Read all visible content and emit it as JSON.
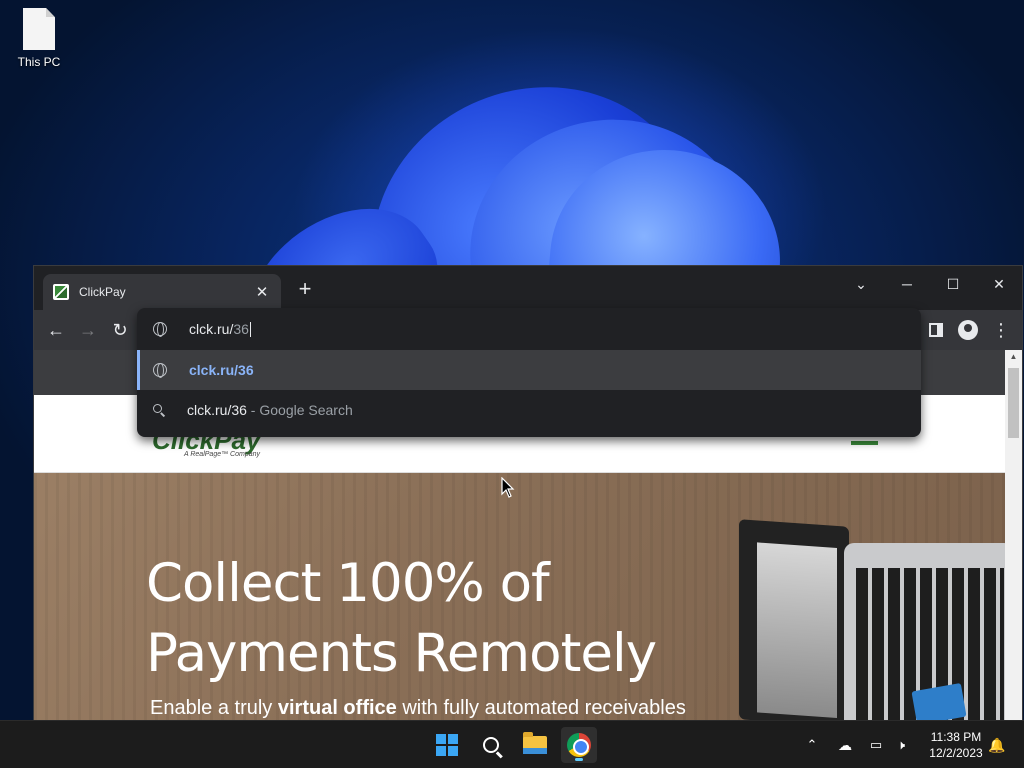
{
  "desktop": {
    "icons": [
      {
        "label": "This PC",
        "icon": "file-icon"
      }
    ]
  },
  "browser": {
    "tab": {
      "title": "ClickPay",
      "favicon": "clickpay-favicon"
    },
    "window_controls": {
      "minimize": "─",
      "maximize": "☐",
      "close": "✕",
      "tab_search": "⌄"
    },
    "omnibox": {
      "typed": "clck.ru/",
      "completion": "36",
      "suggestions": [
        {
          "text": "clck.ru/36",
          "icon": "globe-icon",
          "selected": true
        },
        {
          "text": "clck.ru/36",
          "suffix": " - Google Search",
          "icon": "search-icon",
          "selected": false
        }
      ]
    }
  },
  "page": {
    "logo": "ClickPay",
    "logo_tagline": "A RealPage™ Company",
    "hero_heading_line1": "Collect 100% of",
    "hero_heading_line2": "Payments Remotely",
    "hero_sub_before": "Enable a truly ",
    "hero_sub_bold": "virtual office",
    "hero_sub_after": " with fully automated receivables"
  },
  "taskbar": {
    "time": "11:38 PM",
    "date": "12/2/2023",
    "items": [
      "start",
      "search",
      "file-explorer",
      "chrome"
    ]
  },
  "colors": {
    "accent": "#8ab4f8",
    "chrome_dark": "#202124",
    "toolbar": "#35363a",
    "taskbar": "#1c1c1c"
  }
}
